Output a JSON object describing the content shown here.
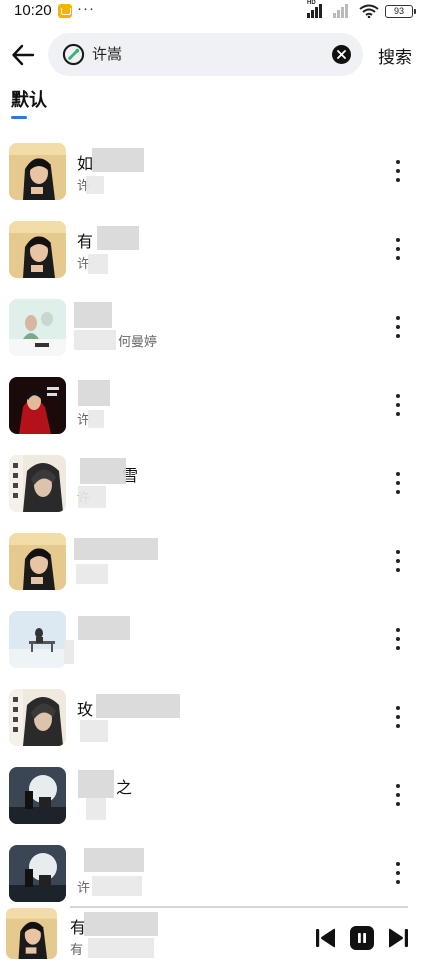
{
  "status_bar": {
    "time": "10:20",
    "dots": "···",
    "hd": "HD",
    "battery": "93"
  },
  "header": {
    "search_value": "许嵩",
    "search_button": "搜索"
  },
  "tabs": [
    {
      "label": "默认"
    }
  ],
  "songs": [
    {
      "title": "如",
      "subtitle": "许",
      "cover": "person-close"
    },
    {
      "title": "有",
      "subtitle": "许",
      "cover": "person-close"
    },
    {
      "title": "",
      "subtitle": "何曼婷",
      "cover": "mint-figures"
    },
    {
      "title": "",
      "subtitle": "许",
      "cover": "red-figure"
    },
    {
      "title": "雪",
      "subtitle": "许",
      "cover": "vertical-text"
    },
    {
      "title": "",
      "subtitle": "",
      "cover": "person-close"
    },
    {
      "title": "",
      "subtitle": "",
      "cover": "sky-bench"
    },
    {
      "title": "玫",
      "subtitle": "",
      "cover": "vertical-text"
    },
    {
      "title": "之",
      "subtitle": "",
      "cover": "moon-night"
    },
    {
      "title": "",
      "subtitle": "许",
      "cover": "moon-night"
    }
  ],
  "player": {
    "title": "有",
    "subtitle": "有"
  },
  "colors": {
    "accent": "#2f74e8",
    "search_bg": "#f0f1f4"
  },
  "icons": [
    "back-arrow-icon",
    "link-logo-icon",
    "clear-icon",
    "more-icon",
    "skip-previous-icon",
    "pause-icon",
    "skip-next-icon"
  ]
}
